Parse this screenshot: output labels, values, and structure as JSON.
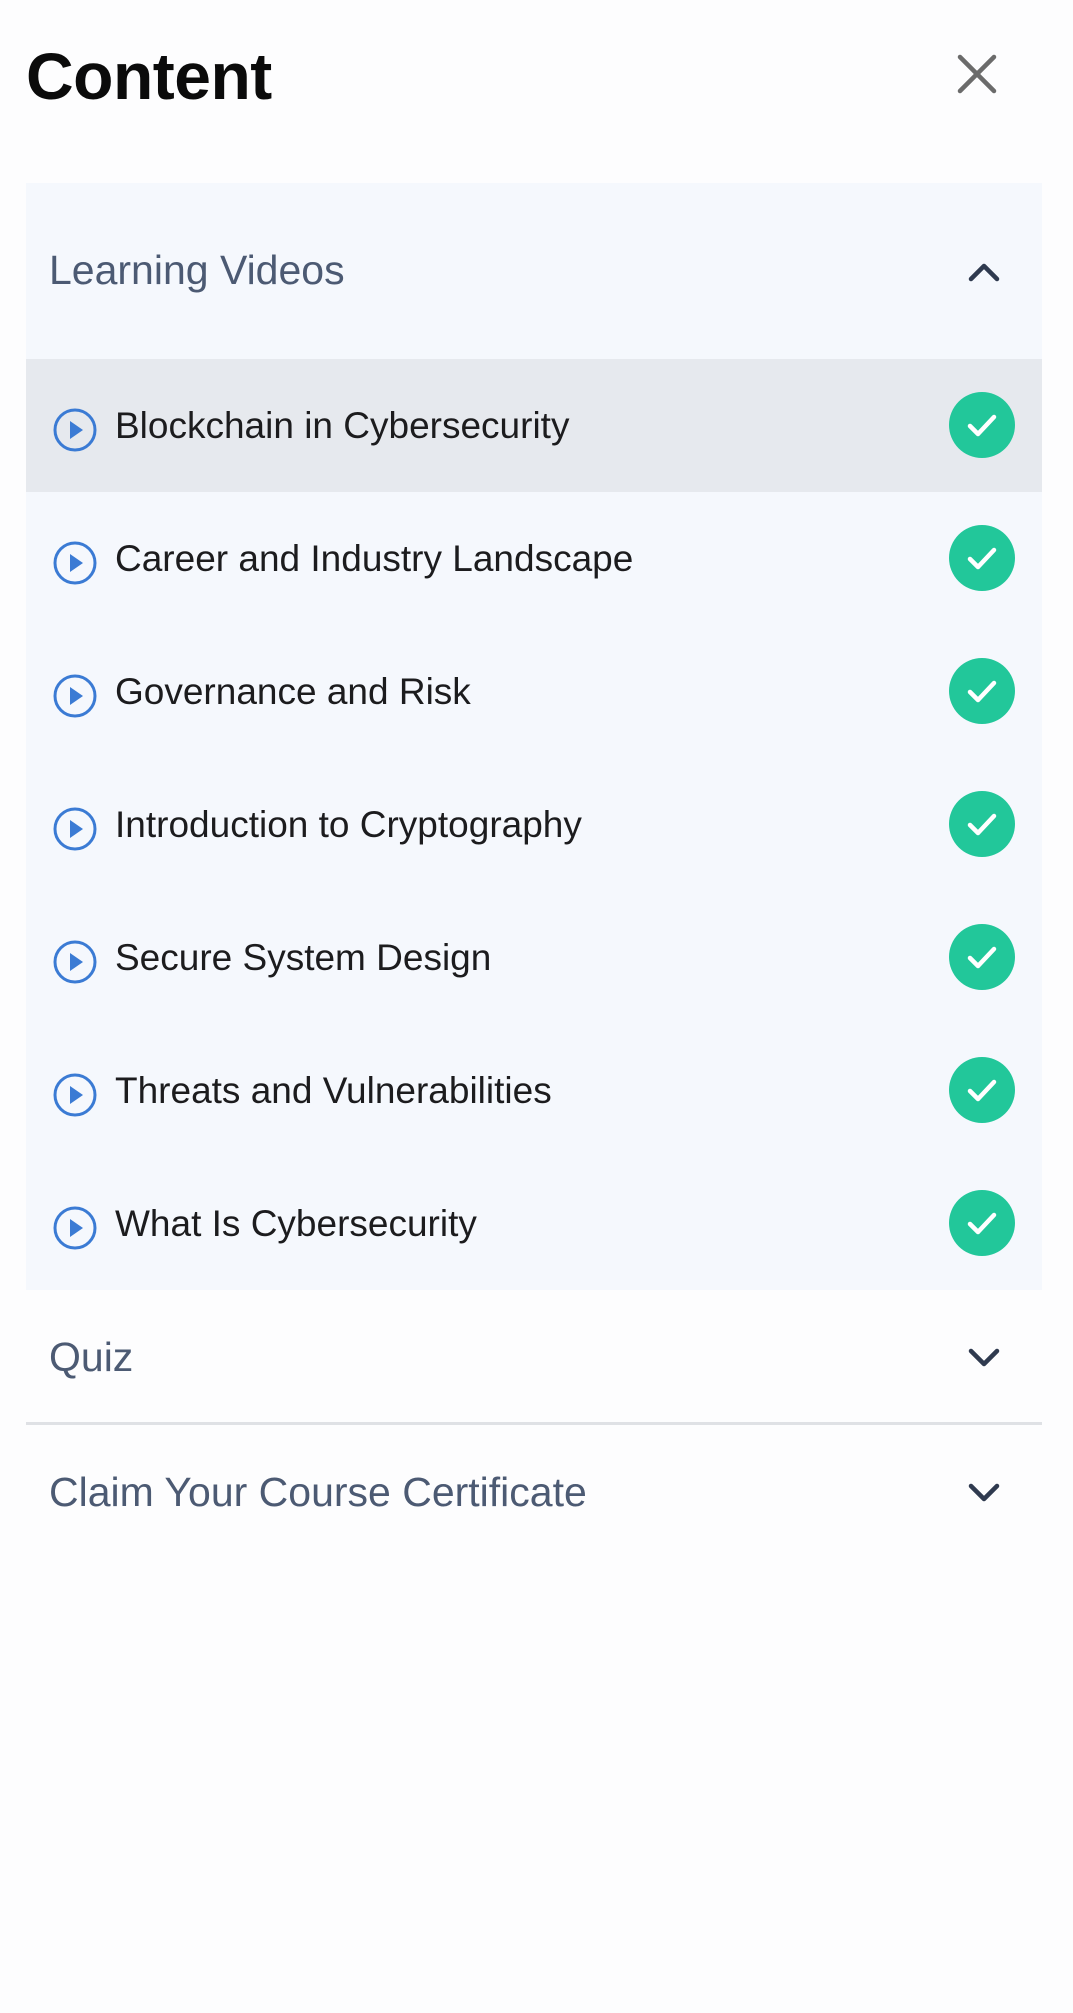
{
  "header": {
    "title": "Content",
    "close_icon": "close-icon"
  },
  "sections": {
    "learning_videos": {
      "label": "Learning Videos",
      "expanded": true,
      "icon": "chevron-up-icon",
      "items": [
        {
          "label": "Blockchain in Cybersecurity",
          "active": true,
          "completed": true
        },
        {
          "label": "Career and Industry Landscape",
          "active": false,
          "completed": true
        },
        {
          "label": "Governance and Risk",
          "active": false,
          "completed": true
        },
        {
          "label": "Introduction to Cryptography",
          "active": false,
          "completed": true
        },
        {
          "label": "Secure System Design",
          "active": false,
          "completed": true
        },
        {
          "label": "Threats and Vulnerabilities",
          "active": false,
          "completed": true
        },
        {
          "label": "What Is Cybersecurity",
          "active": false,
          "completed": true
        }
      ]
    },
    "quiz": {
      "label": "Quiz",
      "expanded": false,
      "icon": "chevron-down-icon"
    },
    "certificate": {
      "label": "Claim Your Course Certificate",
      "expanded": false,
      "icon": "chevron-down-icon"
    }
  },
  "colors": {
    "accent_play": "#3b7bd4",
    "check_green": "#22c79a",
    "section_label": "#4c5a73",
    "panel_bg": "#f5f8fd",
    "active_row_bg": "#e6e9ee"
  }
}
